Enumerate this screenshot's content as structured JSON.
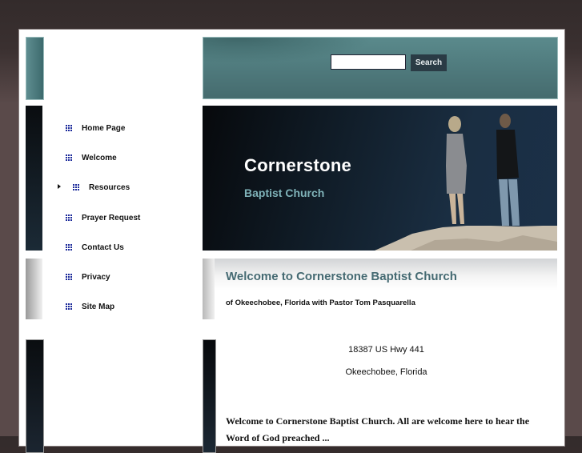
{
  "header": {
    "search": {
      "placeholder": "",
      "value": "",
      "button_label": "Search"
    }
  },
  "banner": {
    "title": "Cornerstone",
    "subtitle": "Baptist Church",
    "image_description": "man and woman standing on rocky cliff under dark blue sky"
  },
  "nav": {
    "items": [
      {
        "label": "Home Page",
        "icon": "grid-bullet-icon",
        "active": false
      },
      {
        "label": "Welcome",
        "icon": "grid-bullet-icon",
        "active": false
      },
      {
        "label": "Resources",
        "icon": "grid-bullet-icon",
        "active": true,
        "has_arrow": true
      },
      {
        "label": "Prayer Request",
        "icon": "grid-bullet-icon",
        "active": false
      },
      {
        "label": "Contact Us",
        "icon": "grid-bullet-icon",
        "active": false
      },
      {
        "label": "Privacy",
        "icon": "grid-bullet-icon",
        "active": false
      },
      {
        "label": "Site Map",
        "icon": "grid-bullet-icon",
        "active": false
      }
    ]
  },
  "main": {
    "welcome_title": "Welcome to Cornerstone Baptist Church",
    "welcome_subtitle": "of Okeechobee, Florida with Pastor Tom Pasquarella",
    "address_line1": "18387 US Hwy 441",
    "address_line2": "Okeechobee, Florida",
    "body_text": "Welcome to Cornerstone Baptist Church.  All are welcome here to hear the Word of God preached ..."
  },
  "colors": {
    "header_teal": "#5a8a8c",
    "banner_subtitle": "#7fb2b8",
    "welcome_title": "#456a72",
    "nav_bullet": "#1c2a9a",
    "search_button_bg": "#2a3b45"
  }
}
